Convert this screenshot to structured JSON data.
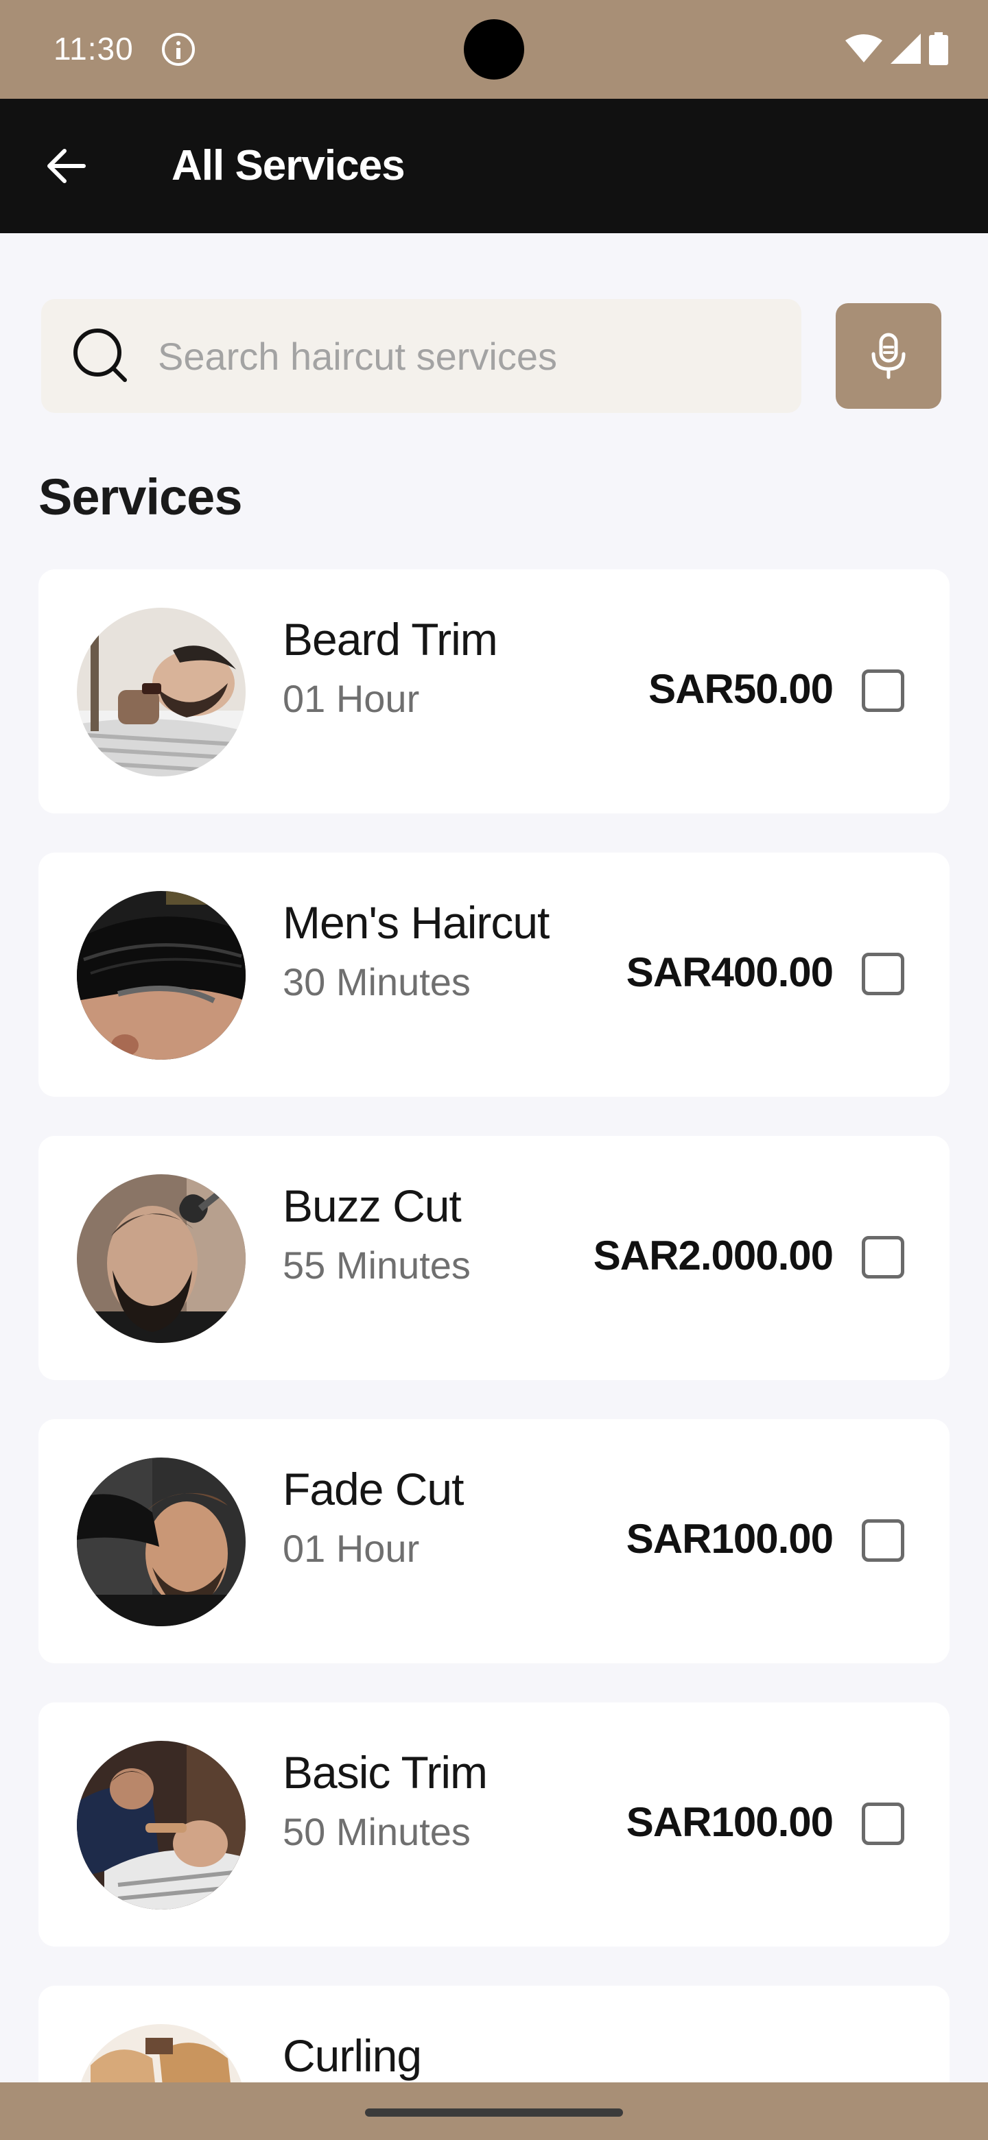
{
  "status_bar": {
    "time": "11:30"
  },
  "app_bar": {
    "title": "All Services",
    "back_icon": "arrow-left-icon"
  },
  "search": {
    "placeholder": "Search haircut services",
    "value": "",
    "icon": "search-icon",
    "mic_icon": "microphone-icon"
  },
  "section_title": "Services",
  "services": [
    {
      "name": "Beard Trim",
      "duration": "01 Hour",
      "price": "SAR50.00",
      "checked": false
    },
    {
      "name": "Men's Haircut",
      "duration": "30 Minutes",
      "price": "SAR400.00",
      "checked": false
    },
    {
      "name": "Buzz Cut",
      "duration": "55 Minutes",
      "price": "SAR2.000.00",
      "checked": false
    },
    {
      "name": "Fade Cut",
      "duration": "01 Hour",
      "price": "SAR100.00",
      "checked": false
    },
    {
      "name": "Basic Trim",
      "duration": "50 Minutes",
      "price": "SAR100.00",
      "checked": false
    },
    {
      "name": "Curling",
      "duration": "",
      "price": "",
      "checked": false
    }
  ],
  "colors": {
    "accent": "#a88f76",
    "app_bar": "#111111",
    "background": "#f6f6fa",
    "search_bg": "#f4f1ec"
  }
}
